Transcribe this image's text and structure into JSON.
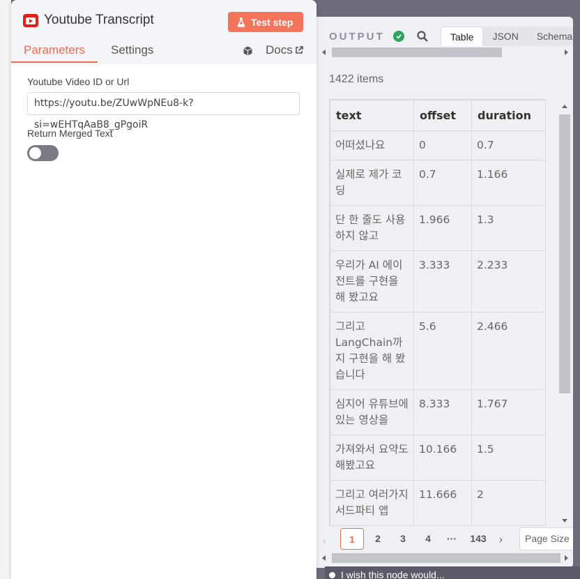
{
  "node": {
    "title": "Youtube Transcript",
    "test_step_label": "Test step",
    "tabs": [
      "Parameters",
      "Settings"
    ],
    "docs_label": "Docs",
    "fields": {
      "video_label": "Youtube Video ID or Url",
      "video_value": "https://youtu.be/ZUwWpNEu8-k?si=wEHTqAaB8_gPgoiR",
      "merged_label": "Return Merged Text",
      "merged_value": false
    }
  },
  "output": {
    "title": "OUTPUT",
    "tabs": [
      "Table",
      "JSON",
      "Schema"
    ],
    "active_tab": "Table",
    "items_count": "1422 items",
    "columns": [
      "text",
      "offset",
      "duration"
    ],
    "rows": [
      {
        "text": "어떠셨나요",
        "offset": "0",
        "duration": "0.7"
      },
      {
        "text": "실제로 제가 코딩",
        "offset": "0.7",
        "duration": "1.166"
      },
      {
        "text": "단 한 줄도 사용하지 않고",
        "offset": "1.966",
        "duration": "1.3"
      },
      {
        "text": "우리가 AI 에이전트를 구현을 해 봤고요",
        "offset": "3.333",
        "duration": "2.233"
      },
      {
        "text": "그리고 LangChain까지 구현을 해 봤습니다",
        "offset": "5.6",
        "duration": "2.466"
      },
      {
        "text": "심지어 유튜브에 있는 영상을",
        "offset": "8.333",
        "duration": "1.767"
      },
      {
        "text": "가져와서 요약도 해봤고요",
        "offset": "10.166",
        "duration": "1.5"
      },
      {
        "text": "그리고 여러가지 서드파티 앱",
        "offset": "11.666",
        "duration": "2"
      }
    ],
    "pagination": {
      "pages": [
        "1",
        "2",
        "3",
        "4",
        "···",
        "143"
      ],
      "active_page": "1",
      "page_size_label": "Page Size"
    }
  },
  "hint_bar": {
    "text": "I wish this node would..."
  },
  "colors": {
    "accent": "#f06a4f",
    "success": "#2ea35f",
    "youtube_red": "#e0201b"
  }
}
